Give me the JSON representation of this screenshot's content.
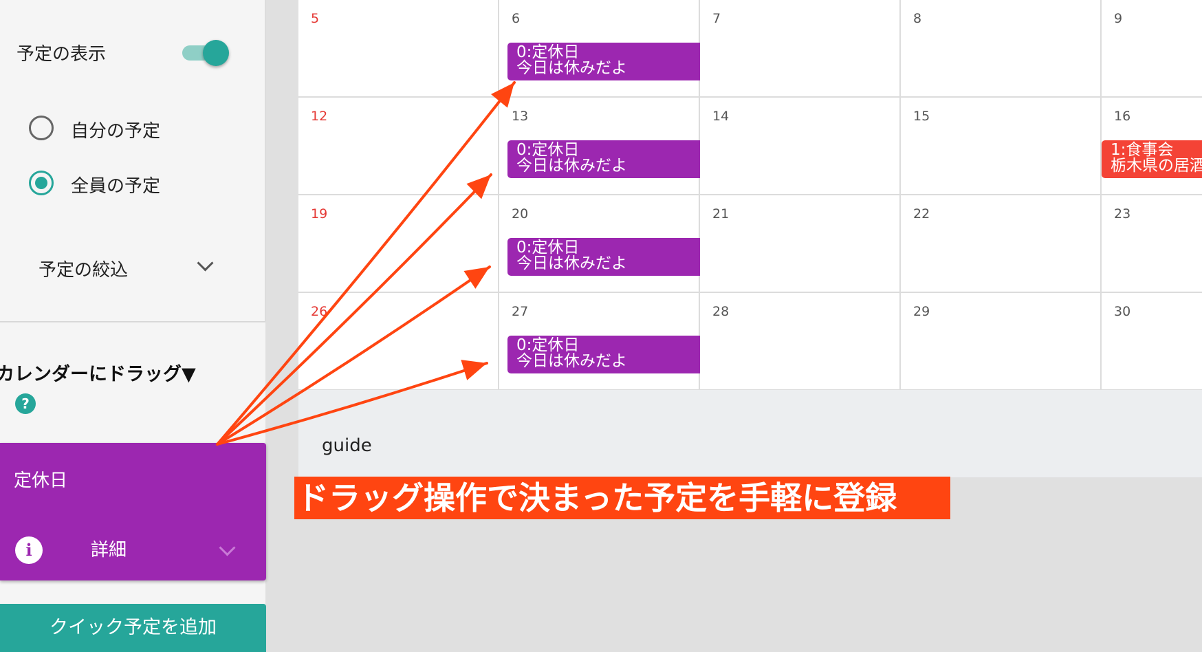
{
  "sidebar": {
    "show_events_label": "予定の表示",
    "show_events_on": true,
    "radio_mine_label": "自分の予定",
    "radio_all_label": "全員の予定",
    "selected_radio": "全員の予定",
    "filter_label": "予定の絞込",
    "drag_title": "カレンダーにドラッグ▼",
    "help_glyph": "?",
    "draggable_event": {
      "name": "定休日",
      "info_glyph": "i",
      "detail_label": "詳細",
      "color": "#9c27b0"
    },
    "quick_add_label": "クイック予定を追加",
    "accent": "#26a69a"
  },
  "calendar": {
    "weeks": [
      [
        {
          "day": "5",
          "sunday": true,
          "events": []
        },
        {
          "day": "6",
          "events": [
            {
              "title": "0:定休日",
              "desc": "今日は休みだよ",
              "color": "#9c27b0"
            }
          ]
        },
        {
          "day": "7",
          "events": []
        },
        {
          "day": "8",
          "events": []
        },
        {
          "day": "9",
          "events": []
        }
      ],
      [
        {
          "day": "12",
          "sunday": true,
          "events": []
        },
        {
          "day": "13",
          "events": [
            {
              "title": "0:定休日",
              "desc": "今日は休みだよ",
              "color": "#9c27b0"
            }
          ]
        },
        {
          "day": "14",
          "events": []
        },
        {
          "day": "15",
          "events": []
        },
        {
          "day": "16",
          "events": [
            {
              "title": "1:食事会",
              "desc": "栃木県の居酒屋",
              "color": "#f44336"
            }
          ]
        }
      ],
      [
        {
          "day": "19",
          "sunday": true,
          "events": []
        },
        {
          "day": "20",
          "events": [
            {
              "title": "0:定休日",
              "desc": "今日は休みだよ",
              "color": "#9c27b0"
            }
          ]
        },
        {
          "day": "21",
          "events": []
        },
        {
          "day": "22",
          "events": []
        },
        {
          "day": "23",
          "events": []
        }
      ],
      [
        {
          "day": "26",
          "sunday": true,
          "events": []
        },
        {
          "day": "27",
          "events": [
            {
              "title": "0:定休日",
              "desc": "今日は休みだよ",
              "color": "#9c27b0"
            }
          ]
        },
        {
          "day": "28",
          "events": []
        },
        {
          "day": "29",
          "events": []
        },
        {
          "day": "30",
          "events": []
        }
      ]
    ]
  },
  "guide_label": "guide",
  "banner_text": "ドラッグ操作で決まった予定を手軽に登録",
  "annotation_color": "#ff4511"
}
